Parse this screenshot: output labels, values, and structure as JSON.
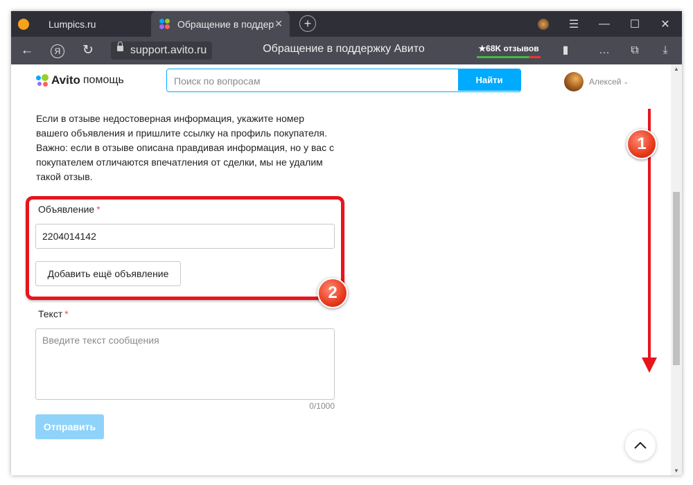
{
  "browser": {
    "tabs": [
      {
        "title": "Lumpics.ru",
        "active": false
      },
      {
        "title": "Обращение в поддерж",
        "active": true
      }
    ],
    "url": "support.avito.ru",
    "page_title": "Обращение в поддержку Авито",
    "reviews_label": "★68K отзывов",
    "new_tab_symbol": "+",
    "close_tab_symbol": "✕"
  },
  "header": {
    "brand": "Avito",
    "brand_suffix": "помощь",
    "search_placeholder": "Поиск по вопросам",
    "search_button": "Найти",
    "user_name": "Алексей"
  },
  "form": {
    "info_text": "Если в отзыве недостоверная информация, укажите номер вашего объявления и пришлите ссылку на профиль покупателя. Важно: если в отзыве описана правдивая информация, но у вас с покупателем отличаются впечатления от сделки, мы не удалим такой отзыв.",
    "ad_label": "Объявление",
    "ad_value": "2204014142",
    "add_ad_button": "Добавить ещё объявление",
    "text_label": "Текст",
    "text_placeholder": "Введите текст сообщения",
    "counter": "0/1000",
    "submit_button": "Отправить",
    "required_mark": "*"
  },
  "annotations": {
    "badge_1": "1",
    "badge_2": "2",
    "accent_color": "#e8141c"
  },
  "colors": {
    "avito_blue": "#00aaff",
    "submit_disabled": "#8fd3fb",
    "browser_dark": "#2f2f38"
  }
}
